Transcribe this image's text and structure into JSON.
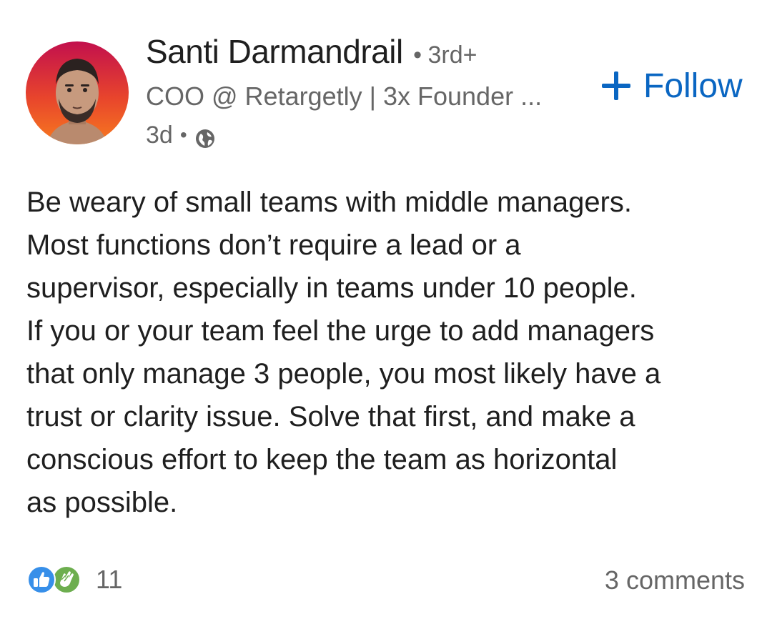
{
  "post": {
    "author": {
      "name": "Santi Darmandrail",
      "separator": "•",
      "degree": "3rd+",
      "headline": "COO @ Retargetly | 3x Founder ...",
      "time": "3d",
      "time_separator": "•",
      "visibility_icon": "globe-icon"
    },
    "follow_label": "Follow",
    "body": "Be weary of small teams with middle managers.\nMost functions don’t require a lead or a\nsupervisor, especially in teams under 10 people.\nIf you or your team feel the urge to add managers\nthat only manage 3 people, you most likely have a\ntrust or clarity issue. Solve that first, and make a\nconscious effort to keep the team as horizontal\nas possible.",
    "reactions": {
      "icons": [
        "like-icon",
        "clap-icon"
      ],
      "count": "11"
    },
    "comments_label": "3 comments"
  },
  "colors": {
    "accent": "#0a66c2",
    "secondary_text": "#666666",
    "primary_text": "#1f1f1f",
    "like": "#378fe9",
    "celebrate": "#6dae4f"
  }
}
